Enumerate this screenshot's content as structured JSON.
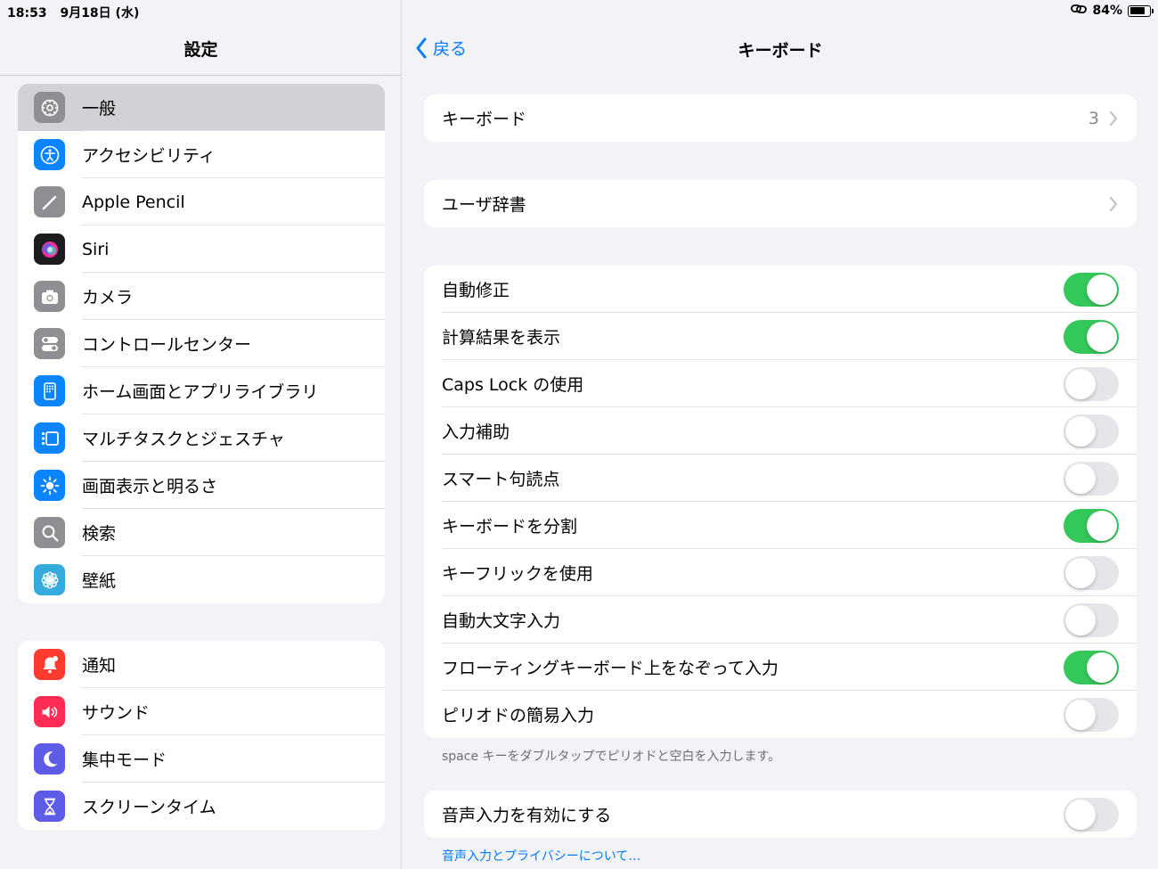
{
  "status": {
    "time": "18:53",
    "date": "9月18日 (水)",
    "battery_percent": "84%",
    "battery_level": 0.84
  },
  "sidebar": {
    "title": "設定",
    "group1": [
      {
        "label": "一般",
        "icon": "gear-icon",
        "color": "#8e8e93",
        "selected": true
      },
      {
        "label": "アクセシビリティ",
        "icon": "accessibility-icon",
        "color": "#0a84ff"
      },
      {
        "label": "Apple Pencil",
        "icon": "pencil-icon",
        "color": "#8e8e93"
      },
      {
        "label": "Siri",
        "icon": "siri-icon",
        "color": "#1c1c1e"
      },
      {
        "label": "カメラ",
        "icon": "camera-icon",
        "color": "#8e8e93"
      },
      {
        "label": "コントロールセンター",
        "icon": "switches-icon",
        "color": "#8e8e93"
      },
      {
        "label": "ホーム画面とアプリライブラリ",
        "icon": "home-screen-icon",
        "color": "#0a84ff"
      },
      {
        "label": "マルチタスクとジェスチャ",
        "icon": "multitask-icon",
        "color": "#0a84ff"
      },
      {
        "label": "画面表示と明るさ",
        "icon": "sun-icon",
        "color": "#0a84ff"
      },
      {
        "label": "検索",
        "icon": "search-icon",
        "color": "#8e8e93"
      },
      {
        "label": "壁紙",
        "icon": "flower-icon",
        "color": "#35aadc"
      }
    ],
    "group2": [
      {
        "label": "通知",
        "icon": "bell-icon",
        "color": "#ff3b30"
      },
      {
        "label": "サウンド",
        "icon": "speaker-icon",
        "color": "#ff2d55"
      },
      {
        "label": "集中モード",
        "icon": "moon-icon",
        "color": "#5e5ce6"
      },
      {
        "label": "スクリーンタイム",
        "icon": "hourglass-icon",
        "color": "#5e5ce6"
      }
    ]
  },
  "nav": {
    "back_label": "戻る",
    "title": "キーボード"
  },
  "keyboards": {
    "label": "キーボード",
    "value": "3"
  },
  "user_dictionary": {
    "label": "ユーザ辞書"
  },
  "toggles": [
    {
      "label": "自動修正",
      "on": true
    },
    {
      "label": "計算結果を表示",
      "on": true
    },
    {
      "label": "Caps Lock の使用",
      "on": false
    },
    {
      "label": "入力補助",
      "on": false
    },
    {
      "label": "スマート句読点",
      "on": false
    },
    {
      "label": "キーボードを分割",
      "on": true
    },
    {
      "label": "キーフリックを使用",
      "on": false
    },
    {
      "label": "自動大文字入力",
      "on": false
    },
    {
      "label": "フローティングキーボード上をなぞって入力",
      "on": true
    },
    {
      "label": "ピリオドの簡易入力",
      "on": false
    }
  ],
  "toggles_footnote": "space キーをダブルタップでピリオドと空白を入力します。",
  "dictation": {
    "label": "音声入力を有効にする",
    "on": false
  },
  "dictation_link": "音声入力とプライバシーについて…"
}
